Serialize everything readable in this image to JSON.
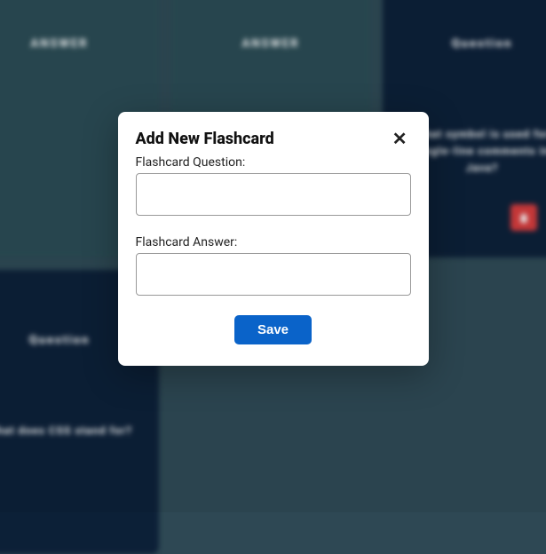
{
  "cards": [
    {
      "title": "ANSWER",
      "body": "",
      "variant": "teal"
    },
    {
      "title": "ANSWER",
      "body": "",
      "variant": "teal"
    },
    {
      "title": "Question",
      "body": "What symbol is used for single-line comments in Java?",
      "variant": "dark",
      "hasTrash": true
    },
    {
      "title": "Question",
      "body": "What does CSS stand for?",
      "variant": "dark",
      "hasTrash": false
    }
  ],
  "modal": {
    "title": "Add New Flashcard",
    "question_label": "Flashcard Question:",
    "answer_label": "Flashcard Answer:",
    "question_value": "",
    "answer_value": "",
    "save_label": "Save"
  }
}
